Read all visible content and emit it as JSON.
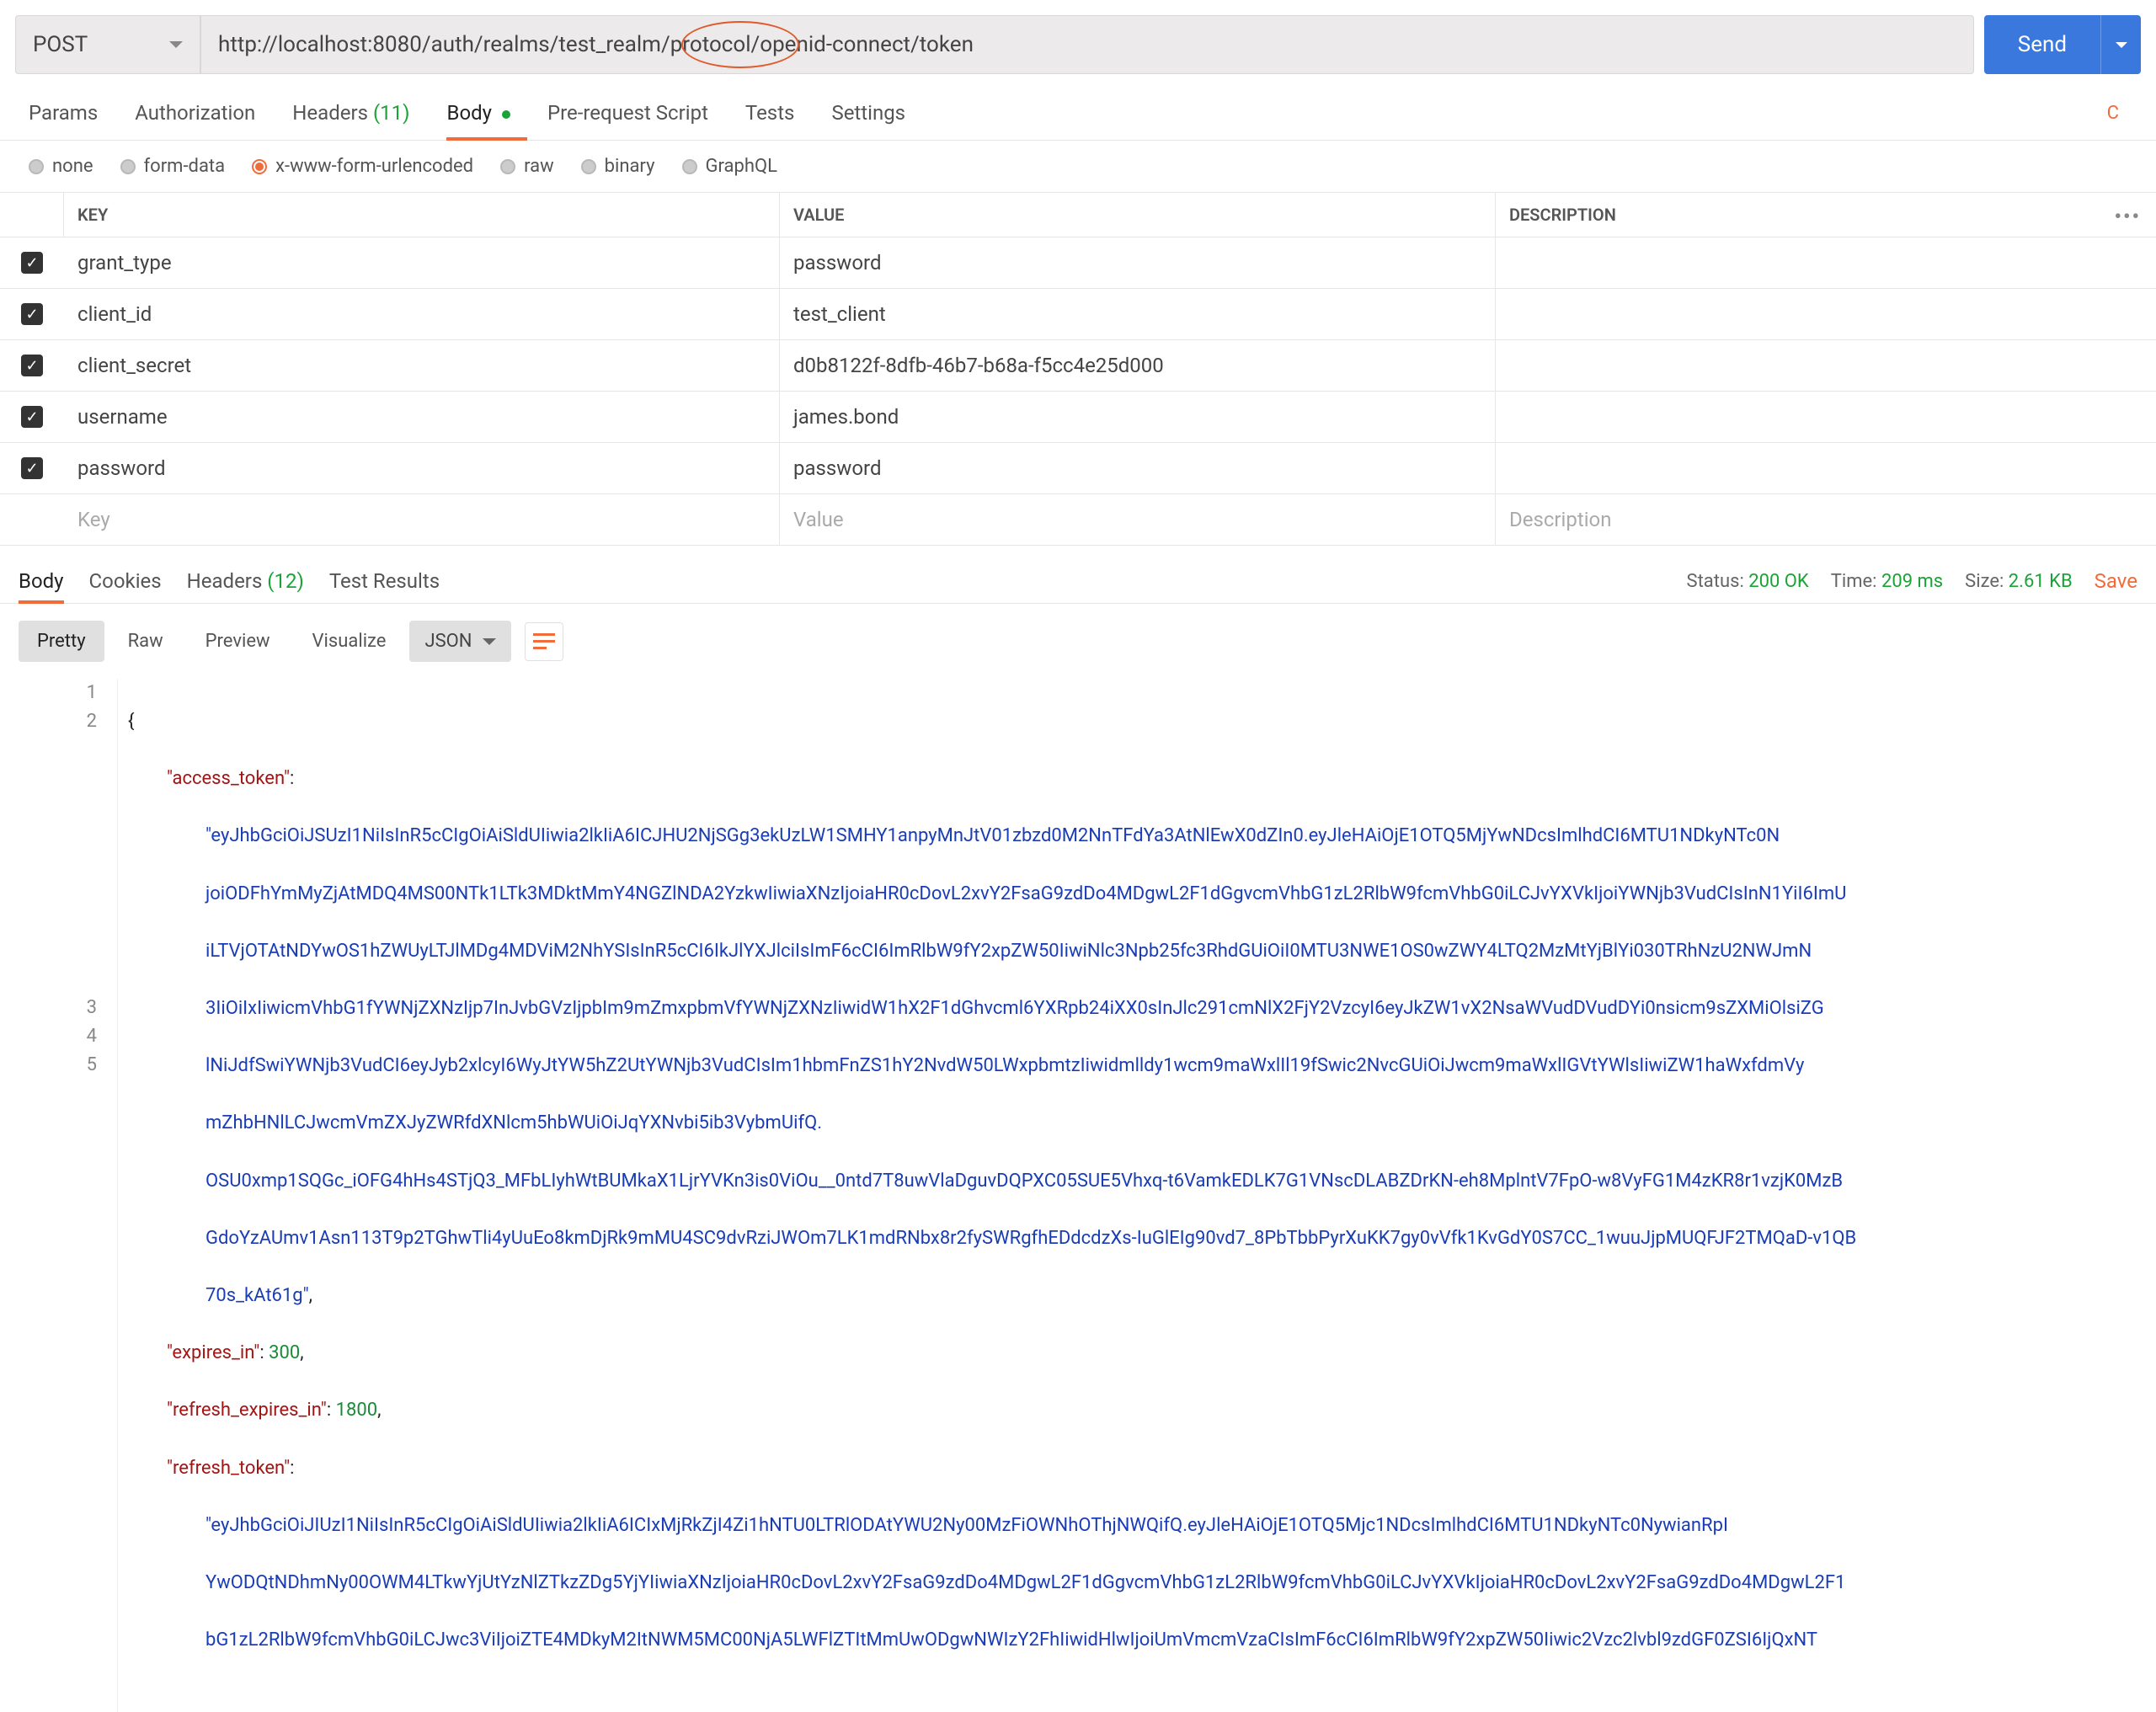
{
  "request": {
    "method": "POST",
    "url": "http://localhost:8080/auth/realms/test_realm/protocol/openid-connect/token",
    "send_label": "Send"
  },
  "req_tabs": {
    "params": "Params",
    "auth": "Authorization",
    "headers": "Headers",
    "headers_count": "(11)",
    "body": "Body",
    "prereq": "Pre-request Script",
    "tests": "Tests",
    "settings": "Settings"
  },
  "body_types": {
    "none": "none",
    "form_data": "form-data",
    "urlencoded": "x-www-form-urlencoded",
    "raw": "raw",
    "binary": "binary",
    "graphql": "GraphQL"
  },
  "kv": {
    "header_key": "KEY",
    "header_value": "VALUE",
    "header_desc": "DESCRIPTION",
    "rows": [
      {
        "key": "grant_type",
        "value": "password",
        "desc": ""
      },
      {
        "key": "client_id",
        "value": "test_client",
        "desc": ""
      },
      {
        "key": "client_secret",
        "value": "d0b8122f-8dfb-46b7-b68a-f5cc4e25d000",
        "desc": ""
      },
      {
        "key": "username",
        "value": "james.bond",
        "desc": ""
      },
      {
        "key": "password",
        "value": "password",
        "desc": ""
      }
    ],
    "ph_key": "Key",
    "ph_value": "Value",
    "ph_desc": "Description"
  },
  "resp_tabs": {
    "body": "Body",
    "cookies": "Cookies",
    "headers": "Headers",
    "headers_count": "(12)",
    "tests": "Test Results"
  },
  "resp_meta": {
    "status_label": "Status:",
    "status_value": "200 OK",
    "time_label": "Time:",
    "time_value": "209 ms",
    "size_label": "Size:",
    "size_value": "2.61 KB",
    "save": "Save"
  },
  "resp_toolbar": {
    "pretty": "Pretty",
    "raw": "Raw",
    "preview": "Preview",
    "visualize": "Visualize",
    "format": "JSON"
  },
  "json_body": {
    "access_token_key": "\"access_token\"",
    "access_token_val_l1": "\"eyJhbGciOiJSUzI1NiIsInR5cCIgOiAiSldUIiwia2lkIiA6ICJHU2NjSGg3ekUzLW1SMHY1anpyMnJtV01zbzd0M2NnTFdYa3AtNlEwX0dZIn0.eyJleHAiOjE1OTQ5MjYwNDcsImlhdCI6MTU1NDkyNTc0N",
    "access_token_val_l2": "joiODFhYmMyZjAtMDQ4MS00NTk1LTk3MDktMmY4NGZlNDA2YzkwIiwiaXNzIjoiaHR0cDovL2xvY2FsaG9zdDo4MDgwL2F1dGgvcmVhbG1zL2RlbW9fcmVhbG0iLCJvYXVkIjoiYWNjb3VudCIsInN1YiI6ImU",
    "access_token_val_l3": "iLTVjOTAtNDYwOS1hZWUyLTJlMDg4MDViM2NhYSIsInR5cCI6IkJlYXJlciIsImF6cCI6ImRlbW9fY2xpZW50IiwiNlc3Npb25fc3RhdGUiOiI0MTU3NWE1OS0wZWY4LTQ2MzMtYjBlYi030TRhNzU2NWJmN",
    "access_token_val_l4": "3IiOiIxIiwicmVhbG1fYWNjZXNzIjp7InJvbGVzIjpbIm9mZmxpbmVfYWNjZXNzIiwidW1hX2F1dGhvcml6YXRpb24iXX0sInJlc291cmNlX2FjY2VzcyI6eyJkZW1vX2NsaWVudDVudDYi0nsicm9sZXMiOlsiZG",
    "access_token_val_l5": "lNiJdfSwiYWNjb3VudCI6eyJyb2xlcyI6WyJtYW5hZ2UtYWNjb3VudCIsIm1hbmFnZS1hY2NvdW50LWxpbmtzIiwidmlldy1wcm9maWxlIl19fSwic2NvcGUiOiJwcm9maWxlIGVtYWlsIiwiZW1haWxfdmVy",
    "access_token_val_l6": "mZhbHNlLCJwcmVmZXJyZWRfdXNlcm5hbWUiOiJqYXNvbi5ib3VybmUifQ.",
    "access_token_val_l7": "OSU0xmp1SQGc_iOFG4hHs4STjQ3_MFbLIyhWtBUMkaX1LjrYVKn3is0ViOu__0ntd7T8uwVlaDguvDQPXC05SUE5Vhxq-t6VamkEDLK7G1VNscDLABZDrKN-eh8MplntV7FpO-w8VyFG1M4zKR8r1vzjK0MzB",
    "access_token_val_l8": "GdoYzAUmv1Asn113T9p2TGhwTli4yUuEo8kmDjRk9mMU4SC9dvRziJWOm7LK1mdRNbx8r2fySWRgfhEDdcdzXs-IuGlEIg90vd7_8PbTbbPyrXuKK7gy0vVfk1KvGdY0S7CC_1wuuJjpMUQFJF2TMQaD-v1QB",
    "access_token_val_l9": "70s_kAt61g\"",
    "expires_in_key": "\"expires_in\"",
    "expires_in_val": "300",
    "refresh_expires_key": "\"refresh_expires_in\"",
    "refresh_expires_val": "1800",
    "refresh_token_key": "\"refresh_token\"",
    "refresh_token_val_l1": "\"eyJhbGciOiJIUzI1NiIsInR5cCIgOiAiSldUIiwia2lkIiA6ICIxMjRkZjI4Zi1hNTU0LTRlODAtYWU2Ny00MzFiOWNhOThjNWQifQ.eyJleHAiOjE1OTQ5Mjc1NDcsImlhdCI6MTU1NDkyNTc0NywianRpI",
    "refresh_token_val_l2": "YwODQtNDhmNy00OWM4LTkwYjUtYzNlZTkzZDg5YjYIiwiaXNzIjoiaHR0cDovL2xvY2FsaG9zdDo4MDgwL2F1dGgvcmVhbG1zL2RlbW9fcmVhbG0iLCJvYXVkIjoiaHR0cDovL2xvY2FsaG9zdDo4MDgwL2F1",
    "refresh_token_val_l3": "bG1zL2RlbW9fcmVhbG0iLCJwc3ViIjoiZTE4MDkyM2ItNWM5MC00NjA5LWFlZTItMmUwODgwNWIzY2FhIiwidHlwIjoiUmVmcmVzaCIsImF6cCI6ImRlbW9fY2xpZW50Iiwic2Vzc2lvbl9zdGF0ZSI6IjQxNT"
  }
}
